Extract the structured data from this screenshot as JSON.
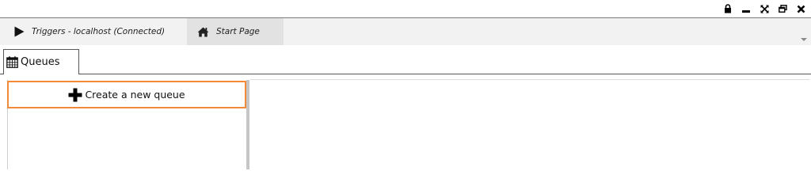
{
  "window": {
    "controls": [
      {
        "icon": "lock-icon"
      },
      {
        "icon": "minimize-icon"
      },
      {
        "icon": "fullscreen-icon"
      },
      {
        "icon": "restore-icon"
      },
      {
        "icon": "close-icon"
      }
    ]
  },
  "doc_tabs": [
    {
      "label": "Triggers - localhost (Connected)",
      "icon": "play-icon",
      "active": true
    },
    {
      "label": "Start Page",
      "icon": "home-icon",
      "active": false
    }
  ],
  "inner_tabs": [
    {
      "label": "Queues",
      "icon": "calendar-icon",
      "active": true
    }
  ],
  "left_panel": {
    "create_button": {
      "label": "Create a new queue",
      "icon": "plus-icon",
      "border_color": "#f28a3a"
    }
  },
  "colors": {
    "accent": "#f28a3a",
    "inactive_tab": "#e2e2e2",
    "tab_strip": "#f2f2f2"
  }
}
